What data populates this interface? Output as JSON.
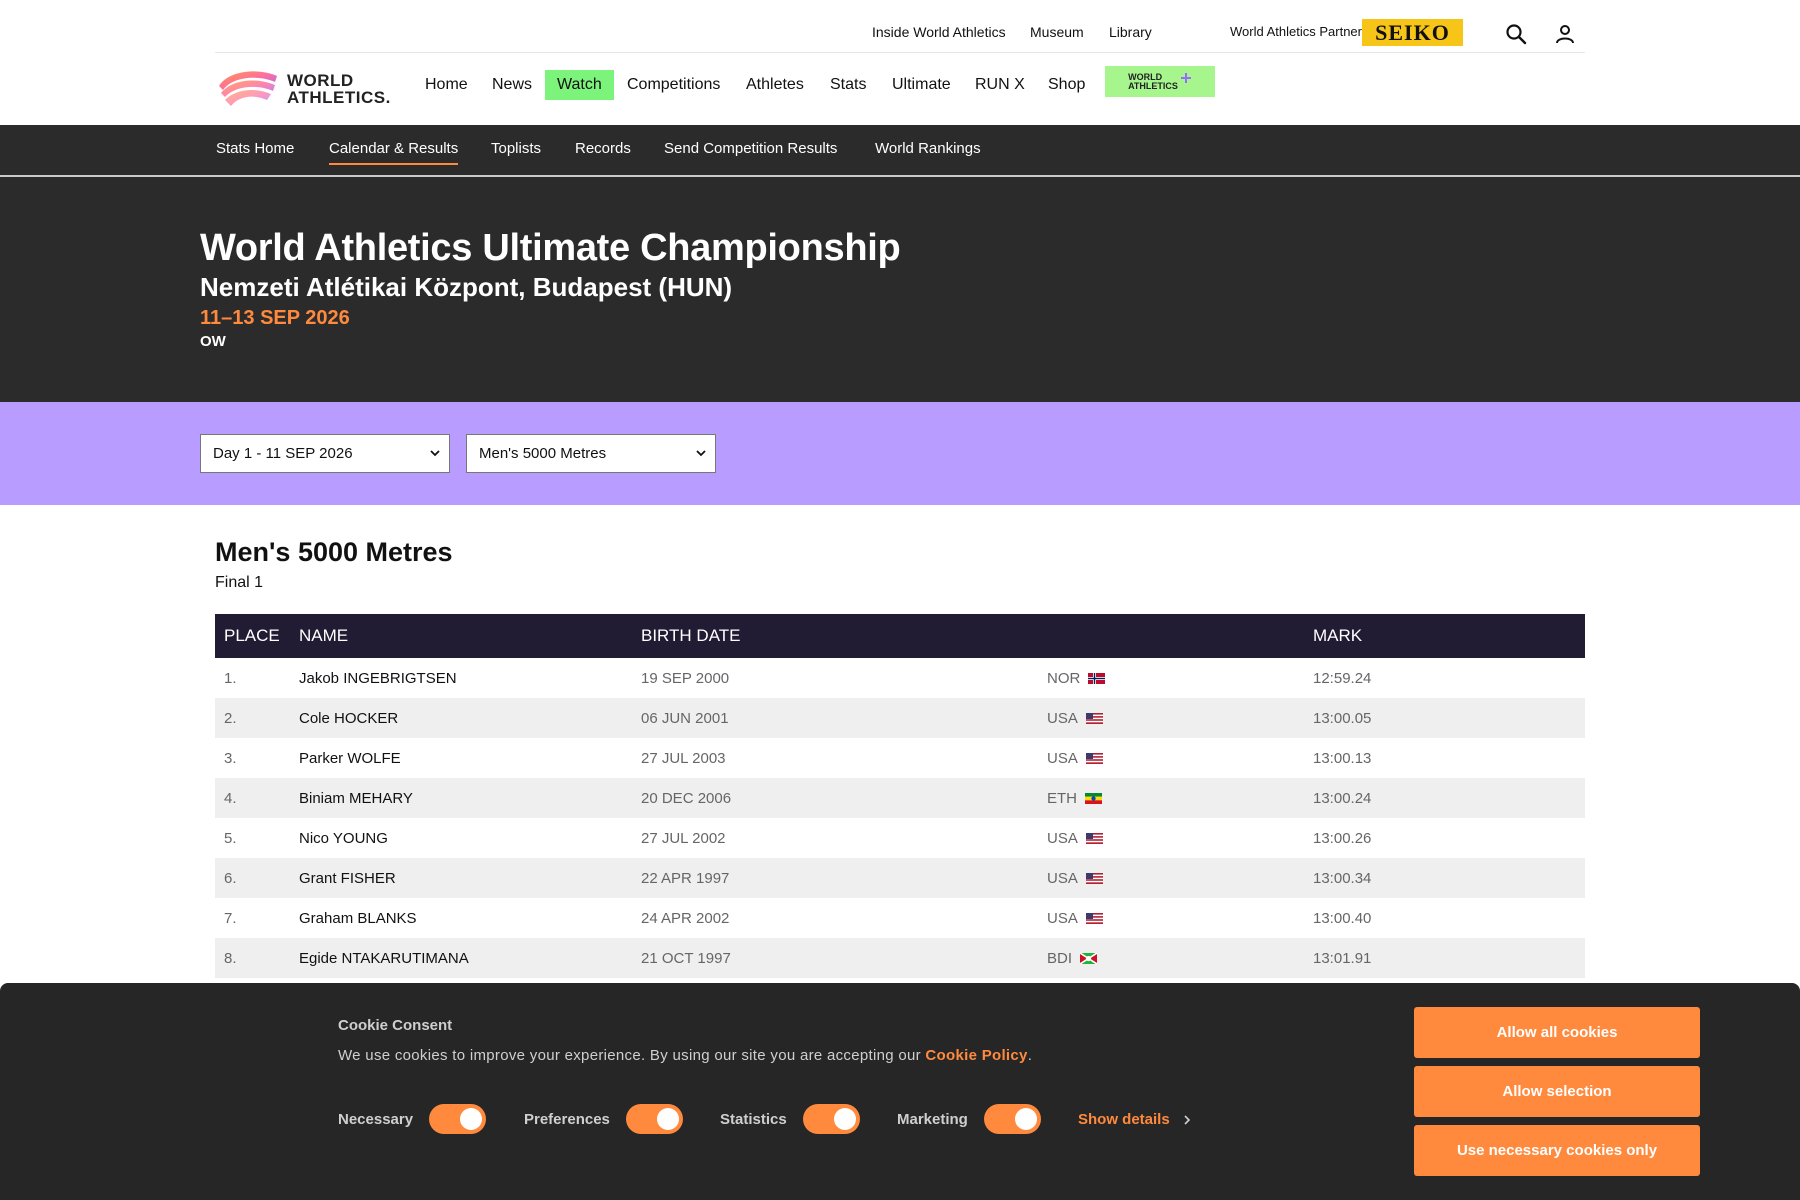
{
  "utility": {
    "links": [
      "Inside World Athletics",
      "Museum",
      "Library"
    ],
    "partner_label": "World Athletics Partner",
    "partner_logo": "SEIKO"
  },
  "logo": {
    "line1": "WORLD",
    "line2": "ATHLETICS."
  },
  "nav": {
    "items": [
      "Home",
      "News",
      "Watch",
      "Competitions",
      "Athletes",
      "Stats",
      "Ultimate",
      "RUN X",
      "Shop"
    ],
    "plus_line1": "WORLD",
    "plus_line2": "ATHLETICS",
    "watch_color": "#7cf37a",
    "plus_color": "#a6f58d"
  },
  "subnav": {
    "items": [
      "Stats Home",
      "Calendar & Results",
      "Toplists",
      "Records",
      "Send Competition Results",
      "World Rankings"
    ],
    "active": "Calendar & Results"
  },
  "hero": {
    "title": "World Athletics Ultimate Championship",
    "venue": "Nemzeti Atlétikai Központ, Budapest (HUN)",
    "dates": "11–13 SEP 2026",
    "category": "OW"
  },
  "filters": {
    "day": "Day 1 - 11 SEP 2026",
    "event": "Men's 5000 Metres"
  },
  "results": {
    "event": "Men's 5000 Metres",
    "round": "Final 1",
    "headers": {
      "place": "PLACE",
      "name": "NAME",
      "birth": "BIRTH DATE",
      "country": "",
      "mark": "MARK"
    },
    "rows": [
      {
        "place": "1.",
        "name": "Jakob INGEBRIGTSEN",
        "birth": "19 SEP 2000",
        "country": "NOR",
        "mark": "12:59.24"
      },
      {
        "place": "2.",
        "name": "Cole HOCKER",
        "birth": "06 JUN 2001",
        "country": "USA",
        "mark": "13:00.05"
      },
      {
        "place": "3.",
        "name": "Parker WOLFE",
        "birth": "27 JUL 2003",
        "country": "USA",
        "mark": "13:00.13"
      },
      {
        "place": "4.",
        "name": "Biniam MEHARY",
        "birth": "20 DEC 2006",
        "country": "ETH",
        "mark": "13:00.24"
      },
      {
        "place": "5.",
        "name": "Nico YOUNG",
        "birth": "27 JUL 2002",
        "country": "USA",
        "mark": "13:00.26"
      },
      {
        "place": "6.",
        "name": "Grant FISHER",
        "birth": "22 APR 1997",
        "country": "USA",
        "mark": "13:00.34"
      },
      {
        "place": "7.",
        "name": "Graham BLANKS",
        "birth": "24 APR 2002",
        "country": "USA",
        "mark": "13:00.40"
      },
      {
        "place": "8.",
        "name": "Egide NTAKARUTIMANA",
        "birth": "21 OCT 1997",
        "country": "BDI",
        "mark": "13:01.91"
      }
    ]
  },
  "cookie": {
    "title": "Cookie Consent",
    "text": "We use cookies to improve your experience. By using our site you are accepting our",
    "link": "Cookie Policy",
    "text_end": ".",
    "toggles": [
      {
        "label": "Necessary",
        "on": true
      },
      {
        "label": "Preferences",
        "on": true
      },
      {
        "label": "Statistics",
        "on": true
      },
      {
        "label": "Marketing",
        "on": true
      }
    ],
    "show_details": "Show details",
    "buttons": [
      "Allow all cookies",
      "Allow selection",
      "Use necessary cookies only"
    ],
    "accent": "#ff8a3d"
  },
  "colors": {
    "hero_bg": "#2b2b2b",
    "filter_band": "#b89cff",
    "table_header": "#211c33",
    "accent_orange": "#ff8a3d"
  },
  "icons": [
    "search-icon",
    "user-icon",
    "chevron-down-icon",
    "chevron-right-icon",
    "flag-icon"
  ]
}
